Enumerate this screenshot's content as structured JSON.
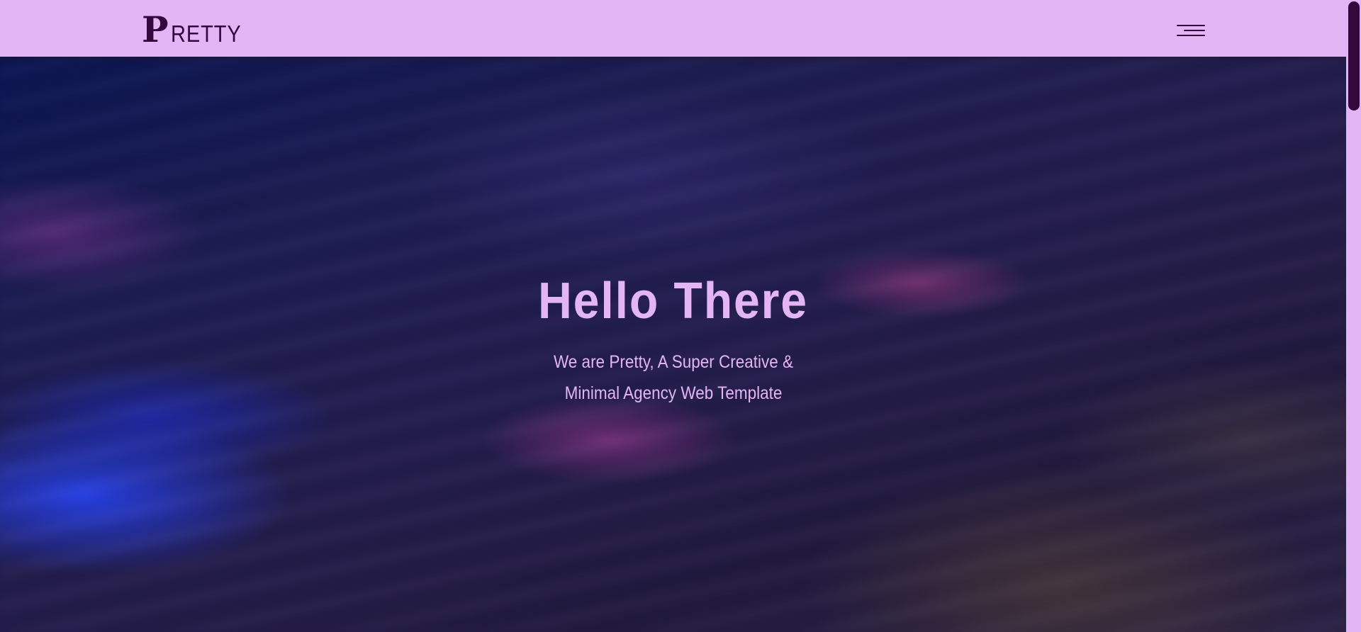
{
  "navbar": {
    "logo_initial": "P",
    "logo_rest": "RETTY",
    "menu_icon": "hamburger-menu-icon"
  },
  "hero": {
    "title": "Hello There",
    "subtitle_line1": "We are Pretty, A Super Creative &",
    "subtitle_line2": "Minimal Agency Web Template"
  },
  "colors": {
    "accent": "#e4b5f4",
    "brand_dark": "#34073d"
  }
}
